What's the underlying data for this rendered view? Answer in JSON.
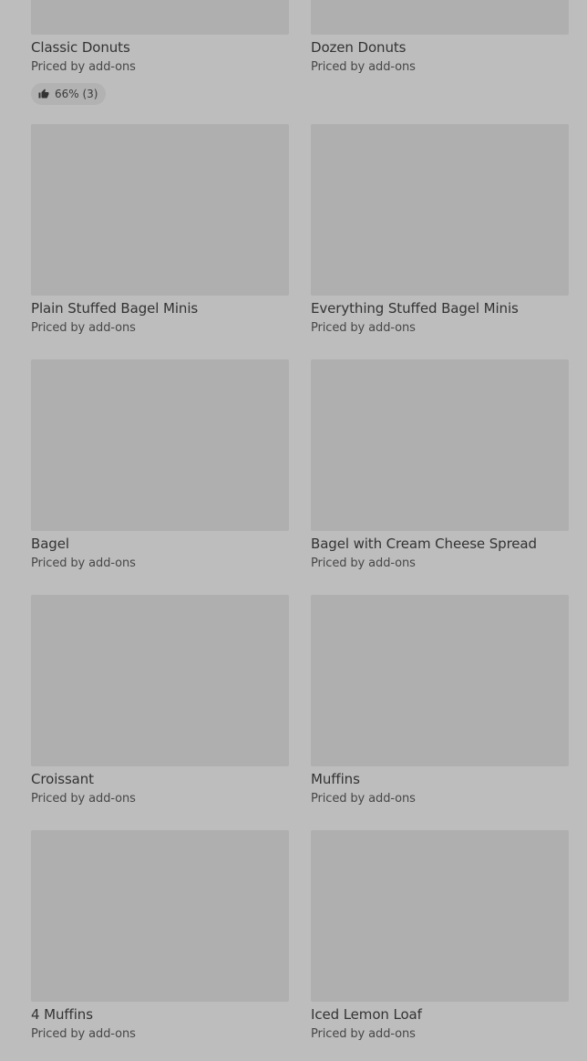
{
  "items": [
    {
      "name": "Classic Donuts",
      "price": "Priced by add-ons",
      "rating": {
        "icon": "thumbs-up-icon",
        "label": "66% (3)"
      }
    },
    {
      "name": "Dozen Donuts",
      "price": "Priced by add-ons"
    },
    {
      "name": "Plain Stuffed Bagel Minis",
      "price": "Priced by add-ons"
    },
    {
      "name": "Everything Stuffed Bagel Minis",
      "price": "Priced by add-ons"
    },
    {
      "name": "Bagel",
      "price": "Priced by add-ons"
    },
    {
      "name": "Bagel with Cream Cheese Spread",
      "price": "Priced by add-ons"
    },
    {
      "name": "Croissant",
      "price": "Priced by add-ons"
    },
    {
      "name": "Muffins",
      "price": "Priced by add-ons"
    },
    {
      "name": "4 Muffins",
      "price": "Priced by add-ons"
    },
    {
      "name": "Iced Lemon Loaf",
      "price": "Priced by add-ons"
    }
  ],
  "colors": {
    "background": "#bdbdbd",
    "image_placeholder": "#afafaf",
    "rating_pill": "#b2b2b2",
    "text": "#333333"
  }
}
